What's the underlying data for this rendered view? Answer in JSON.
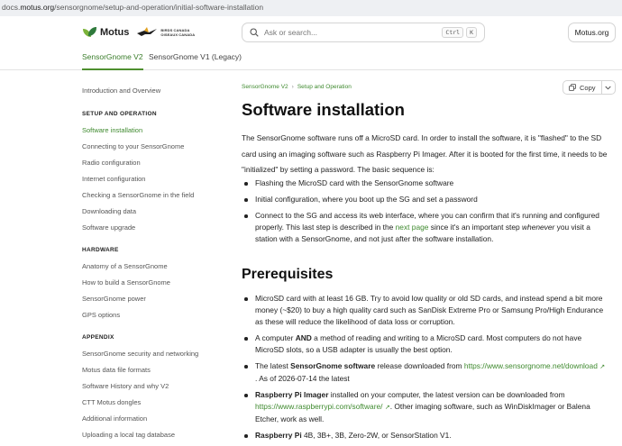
{
  "browser": {
    "url_prefix": "docs.",
    "url_domain": "motus.org",
    "url_path": "/sensorgnome/setup-and-operation/initial-software-installation"
  },
  "header": {
    "logo_text": "Motus",
    "partner_logo_line1": "BIRDS CANADA",
    "partner_logo_line2": "OISEAUX CANADA",
    "search_placeholder": "Ask or search...",
    "shortcut_key1": "Ctrl",
    "shortcut_key2": "K",
    "external_button": "Motus.org",
    "tabs": [
      {
        "label": "SensorGnome V2",
        "active": true
      },
      {
        "label": "SensorGnome V1 (Legacy)",
        "active": false
      }
    ]
  },
  "sidebar": {
    "intro": "Introduction and Overview",
    "sections": [
      {
        "heading": "SETUP AND OPERATION",
        "items": [
          "Software installation",
          "Connecting to your SensorGnome",
          "Radio configuration",
          "Internet configuration",
          "Checking a SensorGnome in the field",
          "Downloading data",
          "Software upgrade"
        ]
      },
      {
        "heading": "HARDWARE",
        "items": [
          "Anatomy of a SensorGnome",
          "How to build a SensorGnome",
          "SensorGnome power",
          "GPS options"
        ]
      },
      {
        "heading": "APPENDIX",
        "items": [
          "SensorGnome security and networking",
          "Motus data file formats",
          "Software History and why V2",
          "CTT Motus dongles",
          "Additional information",
          "Uploading a local tag database"
        ]
      }
    ],
    "active_item": "Software installation"
  },
  "main": {
    "breadcrumb": [
      "SensorGnome V2",
      "Setup and Operation"
    ],
    "copy_label": "Copy",
    "title": "Software installation",
    "intro": "The SensorGnome software runs off a MicroSD card. In order to install the software, it is \"flashed\" to the SD card using an imaging software such as Raspberry Pi Imager. After it is booted for the first time, it needs to be \"initialized\" by setting a password. The basic sequence is:",
    "steps": {
      "s1": "Flashing the MicroSD card with the SensorGnome software",
      "s2": "Initial configuration, where you boot up the SG and set a password",
      "s3_a": "Connect to the SG and access its web interface, where you can confirm that it's running and configured properly. This last step is described in the ",
      "s3_link": "next page",
      "s3_b": " since it's an important step ",
      "s3_em": "whenever",
      "s3_c": " you visit a station with a SensorGnome, and not just after the software installation."
    },
    "prereq_title": "Prerequisites",
    "prereqs": {
      "p1": "MicroSD card with at least 16 GB. Try to avoid low quality or old SD cards, and instead spend a bit more money (~$20) to buy a high quality card such as SanDisk Extreme Pro or Samsung Pro/High Endurance as these will reduce the likelihood of data loss or corruption.",
      "p2_a": "A computer ",
      "p2_b": "AND",
      "p2_c": " a method of reading and writing to a MicroSD card. Most computers do not have MicroSD slots, so a USB adapter is usually the best option.",
      "p3_a": "The latest ",
      "p3_b": "SensorGnome software",
      "p3_c": " release downloaded from ",
      "p3_link": "https://www.sensorgnome.net/download",
      "p3_d": " . As of 2026-07-14 the latest",
      "p4_a": "Raspberry Pi Imager",
      "p4_b": " installed on your computer, the latest version can be downloaded from ",
      "p4_link": "https://www.raspberrypi.com/software/",
      "p4_c": ". Other imaging software, such as WinDiskImager or Balena Etcher, work as well.",
      "p5_a": "Raspberry Pi",
      "p5_b": " 4B, 3B+, 3B, Zero-2W, or SensorStation V1."
    },
    "ext_icon": "↗"
  },
  "colors": {
    "accent": "#3f8a2f",
    "text": "#1f1f1f",
    "border": "#d4d4d4"
  },
  "icons": [
    "motus-leaf-icon",
    "bird-logo-icon",
    "search-icon",
    "copy-icon",
    "chevron-down-icon",
    "external-link-icon"
  ]
}
